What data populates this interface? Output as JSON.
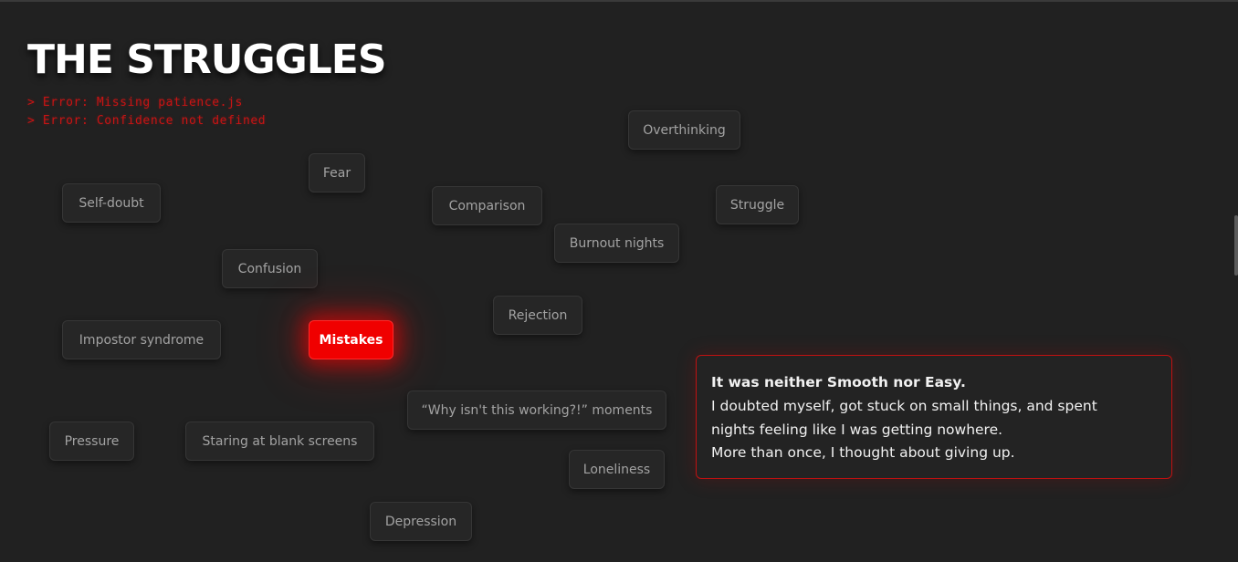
{
  "page": {
    "title": "THE STRUGGLES",
    "errors": [
      "> Error: Missing patience.js",
      "> Error: Confidence not defined"
    ]
  },
  "chips": {
    "overthinking": "Overthinking",
    "fear": "Fear",
    "self_doubt": "Self-doubt",
    "comparison": "Comparison",
    "struggle": "Struggle",
    "burnout_nights": "Burnout nights",
    "confusion": "Confusion",
    "rejection": "Rejection",
    "impostor_syndrome": "Impostor syndrome",
    "mistakes": "Mistakes",
    "why_moments": "“Why isn't this working?!” moments",
    "pressure": "Pressure",
    "blank_screens": "Staring at blank screens",
    "loneliness": "Loneliness",
    "depression": "Depression",
    "active": "Mistakes"
  },
  "card": {
    "lead": "It was neither Smooth nor Easy.",
    "line1": "I doubted myself, got stuck on small things, and spent",
    "line2": "nights feeling like I was getting nowhere.",
    "line3": "More than once, I thought about giving up."
  },
  "colors": {
    "background": "#212121",
    "accent": "#f00000",
    "error_text": "#c81414",
    "chip_text": "#a3a3a3"
  }
}
